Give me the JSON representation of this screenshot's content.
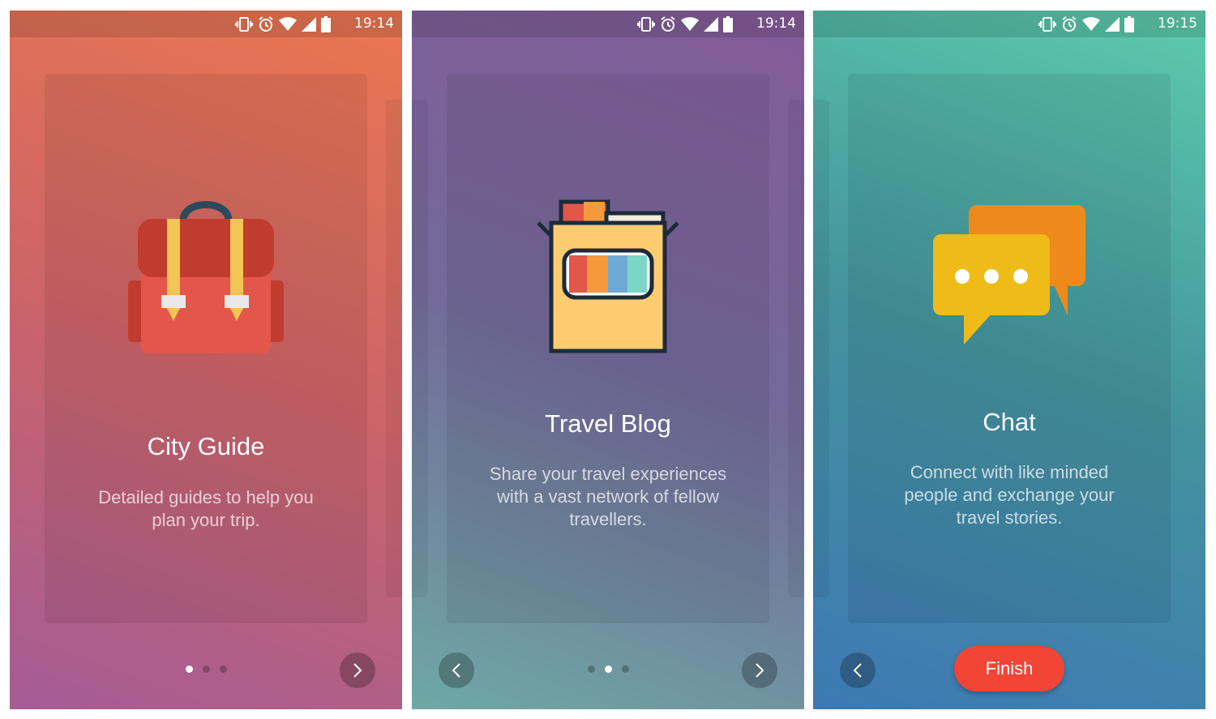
{
  "screens": [
    {
      "time": "19:14",
      "title": "City Guide",
      "description": "Detailed guides to help you plan your trip.",
      "active_dot": 0
    },
    {
      "time": "19:14",
      "title": "Travel Blog",
      "description": "Share your travel experiences with a vast network of fellow travellers.",
      "active_dot": 1
    },
    {
      "time": "19:15",
      "title": "Chat",
      "description": "Connect with like minded people and exchange your travel stories.",
      "finish_label": "Finish"
    }
  ],
  "icons": [
    "vibrate-icon",
    "alarm-icon",
    "wifi-icon",
    "signal-icon",
    "battery-icon",
    "backpack-icon",
    "pencil-box-icon",
    "chat-bubbles-icon",
    "chevron-right-icon",
    "chevron-left-icon"
  ],
  "colors": {
    "finish_button": "#f24535",
    "screen1": "#e0705a",
    "screen2": "#7c6b9c",
    "screen3": "#4b9aa6"
  }
}
